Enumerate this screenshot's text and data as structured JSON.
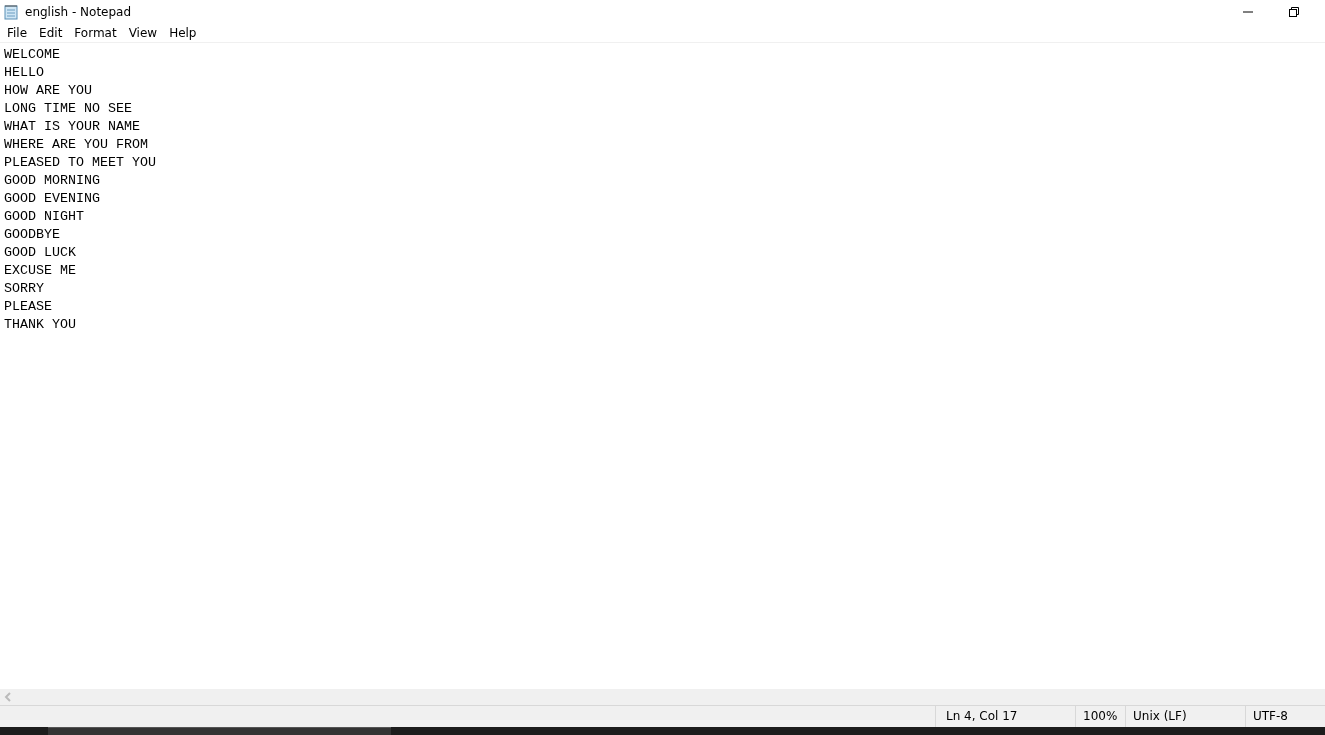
{
  "window": {
    "title": "english - Notepad"
  },
  "menu": [
    "File",
    "Edit",
    "Format",
    "View",
    "Help"
  ],
  "editor": {
    "lines": [
      "WELCOME",
      "HELLO",
      "HOW ARE YOU",
      "LONG TIME NO SEE",
      "WHAT IS YOUR NAME",
      "WHERE ARE YOU FROM",
      "PLEASED TO MEET YOU",
      "GOOD MORNING",
      "GOOD EVENING",
      "GOOD NIGHT",
      "GOODBYE",
      "GOOD LUCK",
      "EXCUSE ME",
      "SORRY",
      "PLEASE",
      "THANK YOU"
    ]
  },
  "status_bar": {
    "position": "Ln 4, Col 17",
    "zoom": "100%",
    "line_endings": "Unix (LF)",
    "encoding": "UTF-8"
  }
}
